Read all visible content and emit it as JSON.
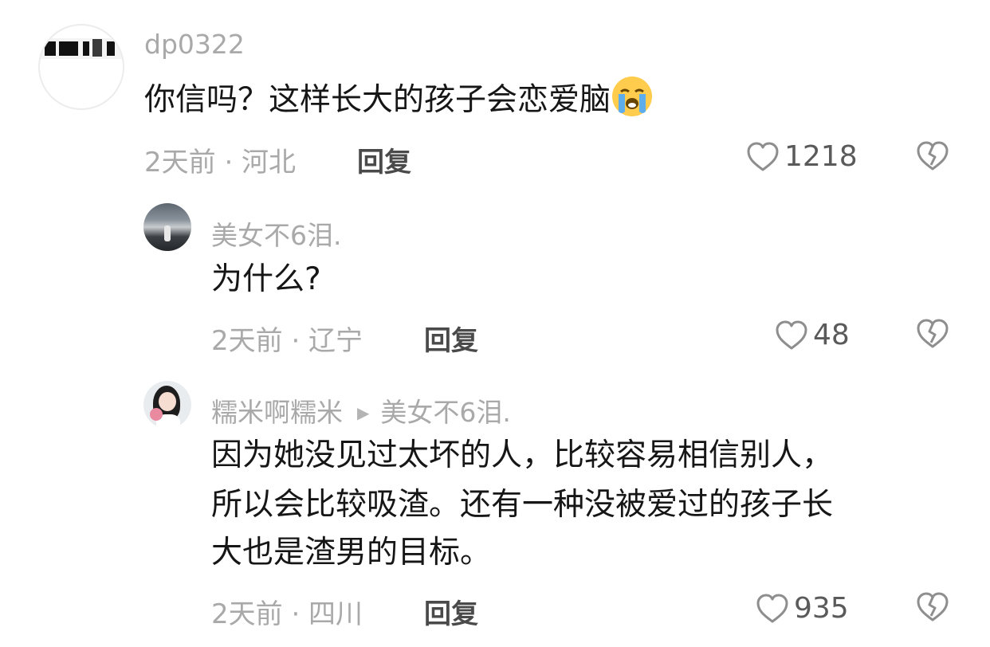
{
  "comments": [
    {
      "username": "dp0322",
      "text": "你信吗？这样长大的孩子会恋爱脑",
      "emoji": "loudly-crying-face-icon",
      "meta": "2天前 · 河北",
      "reply_label": "回复",
      "likes": "1218"
    },
    {
      "username": "美女不6泪.",
      "text": "为什么?",
      "meta": "2天前 · 辽宁",
      "reply_label": "回复",
      "likes": "48"
    },
    {
      "username": "糯米啊糯米",
      "reply_to": "美女不6泪.",
      "text_lines": [
        "因为她没见过太坏的人，比较容易相信别人，",
        "所以会比较吸渣。还有一种没被爱过的孩子长",
        "大也是渣男的目标。"
      ],
      "meta": "2天前 · 四川",
      "reply_label": "回复",
      "likes": "935"
    }
  ],
  "colors": {
    "username": "#a9a9a9",
    "text": "#161616",
    "meta": "#a9a9a9",
    "reply": "#4a4a4a",
    "icon": "#8e8e8e"
  }
}
